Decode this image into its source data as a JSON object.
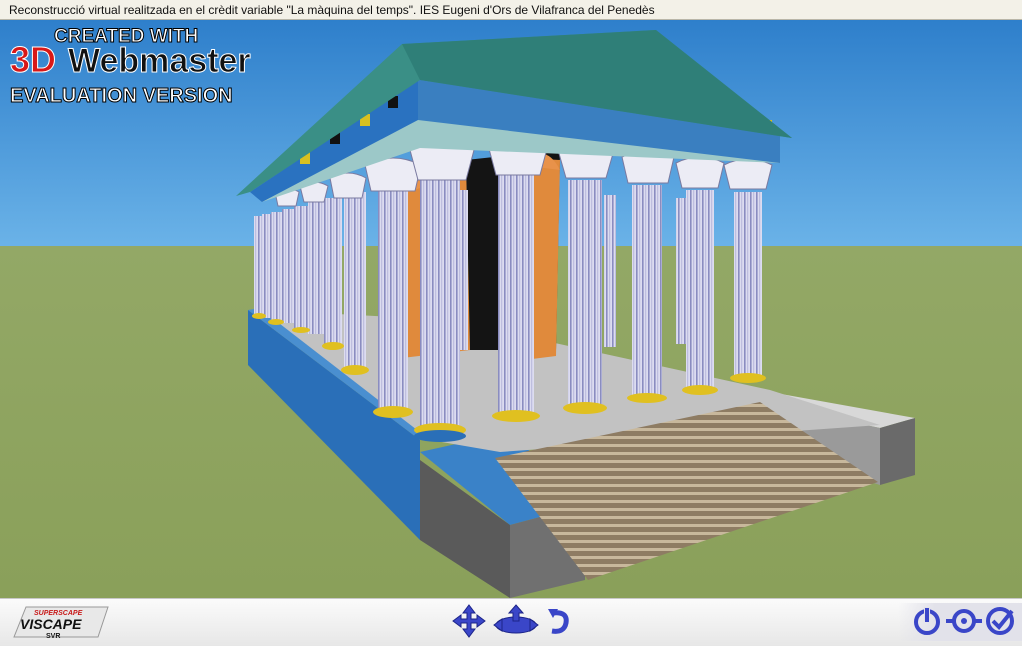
{
  "window": {
    "title": "Reconstrucció virtual realitzada en el crèdit variable \"La màquina del temps\". IES Eugeni d'Ors de Vilafranca del Penedès"
  },
  "watermark": {
    "line1": "CREATED WITH",
    "brand_3d": "3D",
    "brand_name": "Webmaster",
    "line3": "EVALUATION VERSION"
  },
  "player_logo": {
    "top": "SUPERSCAPE",
    "main": "VISCAPE",
    "bottom": "SVR"
  },
  "toolbar": {
    "left_controls": [
      {
        "icon": "move-arrows-icon"
      },
      {
        "icon": "walk-icon"
      },
      {
        "icon": "rotate-icon"
      }
    ],
    "right_controls": [
      {
        "icon": "reset-view-icon"
      },
      {
        "icon": "look-at-icon"
      },
      {
        "icon": "confirm-icon"
      }
    ]
  },
  "colors": {
    "sky": "#3f8fd3",
    "ground": "#8fa560",
    "toolbar_icon": "#3a46c8",
    "watermark_red": "#d81818"
  }
}
